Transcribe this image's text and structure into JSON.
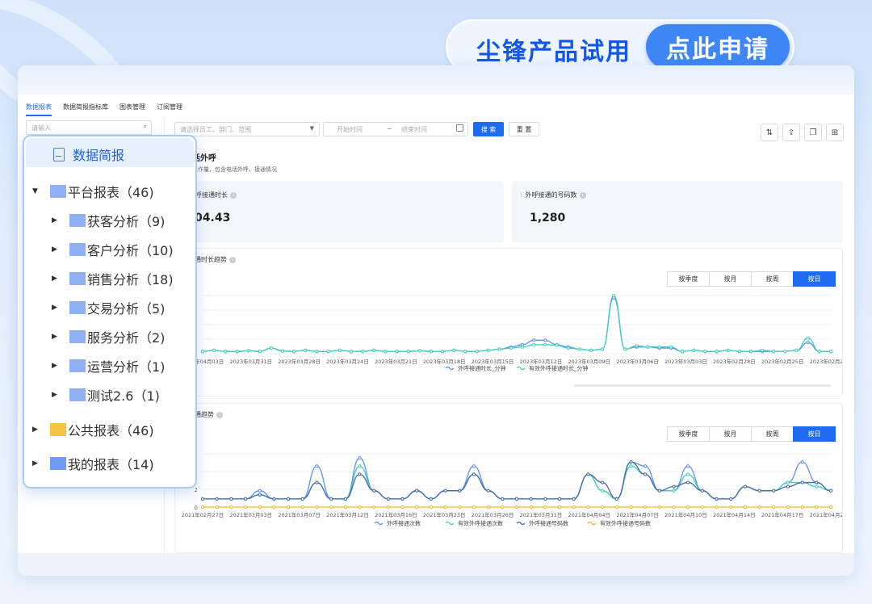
{
  "banner": {
    "text": "尘锋产品试用",
    "button": "点此申请"
  },
  "tabs": [
    "数据报表",
    "数据简报指标库",
    "图表管理",
    "订阅管理"
  ],
  "sidebar": {
    "search_placeholder": "请输入"
  },
  "filters": {
    "staff_placeholder": "请选择员工、部门、范围",
    "start_placeholder": "开始时间",
    "range_sep": "~",
    "end_placeholder": "结束时间",
    "search_button": "搜 索",
    "reset_button": "重 置"
  },
  "tool_icons": [
    "sort-icon",
    "export-icon",
    "copy-icon",
    "add-icon"
  ],
  "report": {
    "title": "话外呼",
    "subtitle": "工作量，包含电话外呼、接通情况"
  },
  "kpis": [
    {
      "label": "效外呼接通时长",
      "value": ",104.43"
    },
    {
      "label": "外呼接通的号码数",
      "value": "1,280"
    }
  ],
  "period_tabs": [
    "按季度",
    "按月",
    "按周",
    "按日"
  ],
  "active_period": "按日",
  "tree": {
    "header": "数据简报",
    "items": [
      {
        "label": "平台报表（46)",
        "expanded": true,
        "children": [
          "获客分析（9)",
          "客户分析（10)",
          "销售分析（18)",
          "交易分析（5)",
          "服务分析（2)",
          "运营分析（1)",
          "测试2.6（1)"
        ]
      },
      {
        "label": "公共报表（46)"
      },
      {
        "label": "我的报表（14)"
      }
    ],
    "colors": {
      "folder_blue": "#8fb0f5",
      "folder_yellow": "#f6c343"
    }
  },
  "chart_data": [
    {
      "type": "line",
      "title": "呼接通时长趋势",
      "categories": [
        "2023年04月03日",
        "2023年03月31日",
        "2023年03月28日",
        "2023年03月24日",
        "2023年03月21日",
        "2023年03月18日",
        "2023年03月15日",
        "2023年03月12日",
        "2023年03月09日",
        "2023年03月06日",
        "2023年03月03日",
        "2023年02月28日",
        "2023年02月25日",
        "2023年02月21日"
      ],
      "series": [
        {
          "name": "外呼接通时长_分钟",
          "color": "#5b8ff0",
          "values": [
            1,
            1.5,
            1,
            1,
            1.3,
            1,
            2.5,
            1.2,
            1,
            1.5,
            1,
            1,
            1.5,
            1,
            1,
            1.5,
            1,
            1,
            1,
            1.3,
            1,
            1,
            1.5,
            1,
            1,
            1.5,
            2,
            3,
            4,
            6,
            6,
            4,
            3,
            2,
            1.5,
            2,
            25,
            2,
            3,
            3,
            2.5,
            2.5,
            1,
            1.5,
            1,
            1,
            1.5,
            1,
            1,
            1,
            1,
            1,
            1.5,
            5,
            1,
            1
          ]
        },
        {
          "name": "有效外呼接通时长_分钟",
          "color": "#3fd2b8",
          "values": [
            1,
            1.5,
            1,
            1,
            1.3,
            1,
            2.5,
            1.2,
            1,
            1.5,
            1,
            1,
            1.5,
            1,
            1,
            1.5,
            1,
            1,
            1,
            1.3,
            1,
            1,
            1.5,
            1,
            1,
            1.5,
            2,
            2.5,
            3,
            4,
            4,
            3.8,
            2.5,
            2,
            1.5,
            2,
            26,
            2,
            3.5,
            3,
            3,
            3,
            1,
            1.5,
            1,
            1,
            1.5,
            1,
            1,
            1.5,
            1,
            1,
            1.5,
            7,
            1,
            1
          ]
        }
      ]
    },
    {
      "type": "line",
      "title": "呼接通趋势",
      "y_ticks": [
        "0",
        "2"
      ],
      "categories": [
        "2021年02月27日",
        "2021年03月03日",
        "2021年03月07日",
        "2021年03月12日",
        "2021年03月16日",
        "2021年03月23日",
        "2021年03月26日",
        "2021年03月31日",
        "2021年04月04日",
        "2021年04月07日",
        "2021年04月10日",
        "2021年04月14日",
        "2021年04月17日",
        "2021年04月22日"
      ],
      "series": [
        {
          "name": "外呼接通次数",
          "color": "#5b8ff0",
          "values": [
            1,
            1,
            1,
            1,
            2,
            1,
            1,
            1,
            5,
            1,
            1,
            6,
            2,
            1,
            1,
            2,
            1,
            2,
            2,
            5,
            2,
            1,
            1,
            1,
            1,
            1,
            1,
            4,
            2,
            1,
            5.5,
            5,
            2,
            2,
            5,
            2,
            1,
            1,
            2.5,
            2,
            2,
            3,
            5.5,
            3,
            2
          ]
        },
        {
          "name": "有效外呼接通次数",
          "color": "#3fd2b8",
          "values": [
            1,
            1,
            1,
            1,
            1.5,
            1,
            1,
            1,
            3,
            1,
            1,
            5,
            2,
            1,
            1,
            2,
            1,
            2,
            2,
            4,
            2,
            1,
            1,
            1,
            1,
            1,
            1,
            4,
            2,
            1,
            5,
            4,
            2,
            2,
            4,
            2,
            1,
            1,
            2.5,
            2,
            2,
            3,
            3,
            2.5,
            2
          ]
        },
        {
          "name": "外呼接通号码数",
          "color": "#4868a8",
          "values": [
            1,
            1,
            1,
            1,
            1.5,
            1,
            1,
            1,
            3,
            1,
            1,
            4,
            2,
            1,
            1,
            2,
            1,
            2,
            2,
            4,
            2,
            1,
            1,
            1,
            1,
            1,
            1,
            4,
            3,
            1,
            5.5,
            4,
            2,
            2.5,
            3,
            2,
            1,
            1,
            2.5,
            2,
            2,
            2.5,
            3,
            3,
            2
          ]
        },
        {
          "name": "有效外呼接通号码数",
          "color": "#f5b72f",
          "values": [
            0,
            0,
            0,
            0,
            0,
            0,
            0,
            0,
            0,
            0,
            0,
            0,
            0,
            0,
            0,
            0,
            0,
            0,
            0,
            0,
            0,
            0,
            0,
            0,
            0,
            0,
            0,
            0,
            0,
            0,
            0,
            0,
            0,
            0,
            0,
            0,
            0,
            0,
            0,
            0,
            0,
            0,
            0,
            0,
            0
          ]
        }
      ]
    }
  ]
}
